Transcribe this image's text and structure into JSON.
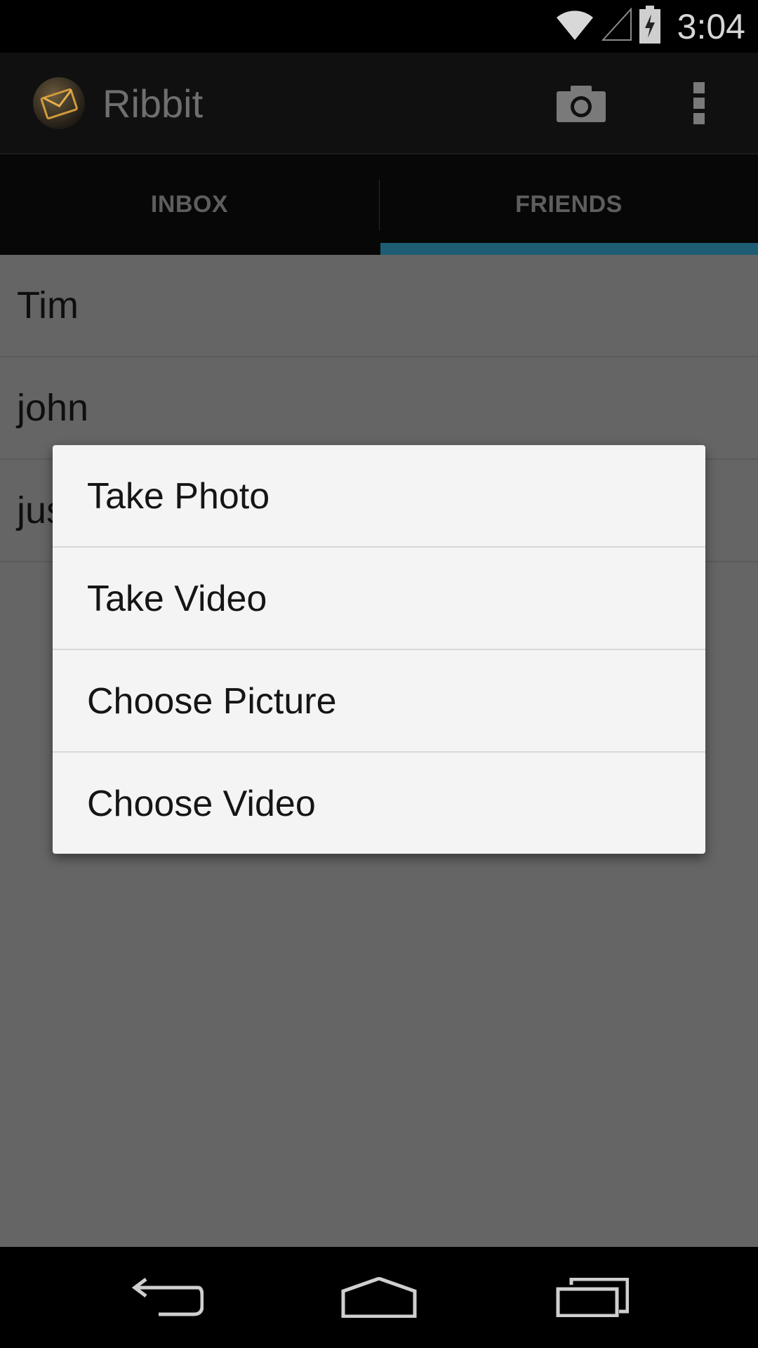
{
  "status_bar": {
    "time": "3:04",
    "icons": [
      "wifi-icon",
      "cell-signal-icon",
      "battery-charging-icon"
    ]
  },
  "action_bar": {
    "title": "Ribbit",
    "logo": "envelope-logo",
    "actions": [
      "camera-icon",
      "overflow-menu-icon"
    ]
  },
  "tabs": [
    {
      "label": "INBOX",
      "selected": false
    },
    {
      "label": "FRIENDS",
      "selected": true
    }
  ],
  "colors": {
    "tab_indicator": "#1f5d74",
    "dialog_background": "#f4f4f4",
    "dim_background": "#656565"
  },
  "friends": [
    {
      "name": "Tim"
    },
    {
      "name": "john"
    },
    {
      "name": "jus"
    }
  ],
  "dialog": {
    "items": [
      {
        "label": "Take Photo"
      },
      {
        "label": "Take Video"
      },
      {
        "label": "Choose Picture"
      },
      {
        "label": "Choose Video"
      }
    ]
  },
  "nav_bar": {
    "buttons": [
      "back-icon",
      "home-icon",
      "recent-apps-icon"
    ]
  }
}
